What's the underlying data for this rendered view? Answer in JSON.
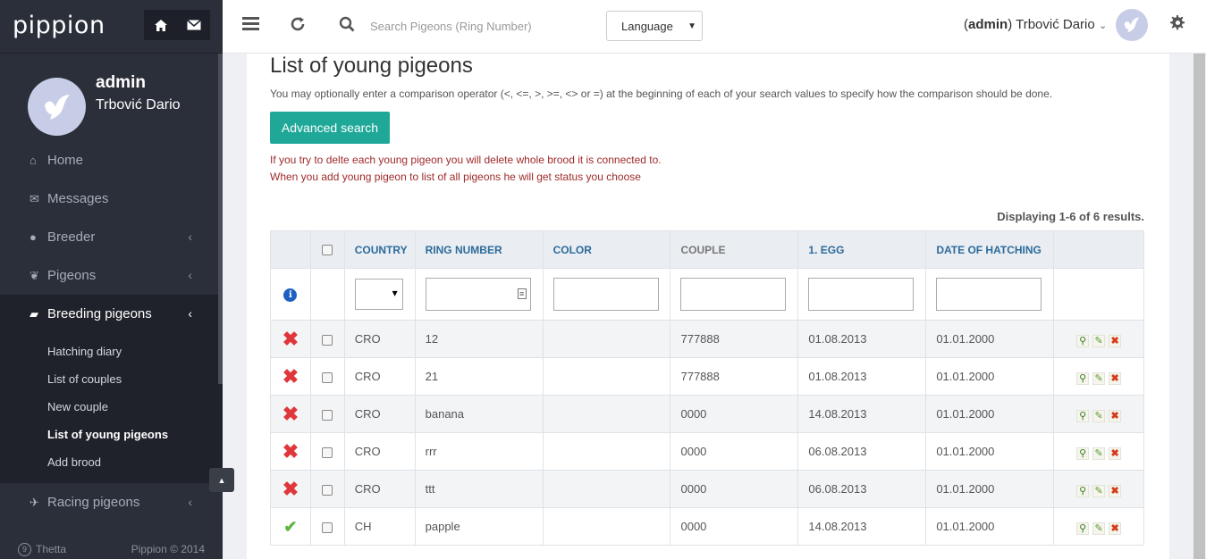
{
  "app": {
    "logo": "pippion"
  },
  "profile": {
    "name": "admin",
    "full_name": "Trbović Dario"
  },
  "nav": {
    "items": [
      {
        "label": "Home",
        "icon": "home-icon"
      },
      {
        "label": "Messages",
        "icon": "envelope-icon"
      },
      {
        "label": "Breeder",
        "icon": "user-icon"
      },
      {
        "label": "Pigeons",
        "icon": "bird-icon"
      },
      {
        "label": "Breeding pigeons",
        "icon": "truck-icon"
      },
      {
        "label": "Racing pigeons",
        "icon": "plane-icon"
      }
    ],
    "sub_items": [
      "Hatching diary",
      "List of couples",
      "New couple",
      "List of young pigeons",
      "Add brood"
    ]
  },
  "footer": {
    "left": "Thetta",
    "right": "Pippion © 2014"
  },
  "topbar": {
    "search_placeholder": "Search Pigeons (Ring Number)",
    "language": "Language",
    "user_role": "admin",
    "user_name": "Trbović Dario"
  },
  "page": {
    "title": "List of young pigeons",
    "hint": "You may optionally enter a comparison operator (<, <=, >, >=, <> or =) at the beginning of each of your search values to specify how the comparison should be done.",
    "advanced_search": "Advanced search",
    "warning_1": "If you try to delte each young pigeon you will delete whole brood it is connected to.",
    "warning_2": "When you add young pigeon to list of all pigeons he will get status you choose",
    "display": "Displaying 1-6 of 6 results."
  },
  "table": {
    "headers": [
      "COUNTRY",
      "RING NUMBER",
      "COLOR",
      "COUPLE",
      "1. EGG",
      "DATE OF HATCHING"
    ],
    "rows": [
      {
        "status": "x",
        "country": "CRO",
        "ring": "12",
        "color": "",
        "couple": "777888",
        "egg": "01.08.2013",
        "hatch": "01.01.2000"
      },
      {
        "status": "x",
        "country": "CRO",
        "ring": "21",
        "color": "",
        "couple": "777888",
        "egg": "01.08.2013",
        "hatch": "01.01.2000"
      },
      {
        "status": "x",
        "country": "CRO",
        "ring": "banana",
        "color": "",
        "couple": "0000",
        "egg": "14.08.2013",
        "hatch": "01.01.2000"
      },
      {
        "status": "x",
        "country": "CRO",
        "ring": "rrr",
        "color": "",
        "couple": "0000",
        "egg": "06.08.2013",
        "hatch": "01.01.2000"
      },
      {
        "status": "x",
        "country": "CRO",
        "ring": "ttt",
        "color": "",
        "couple": "0000",
        "egg": "06.08.2013",
        "hatch": "01.01.2000"
      },
      {
        "status": "ok",
        "country": "CH",
        "ring": "papple",
        "color": "",
        "couple": "0000",
        "egg": "14.08.2013",
        "hatch": "01.01.2000"
      }
    ]
  },
  "colors": {
    "accent": "#1fa898",
    "sidebar": "#2b2f3a",
    "warning": "#a02b2b",
    "header_link": "#2c6b9c"
  }
}
